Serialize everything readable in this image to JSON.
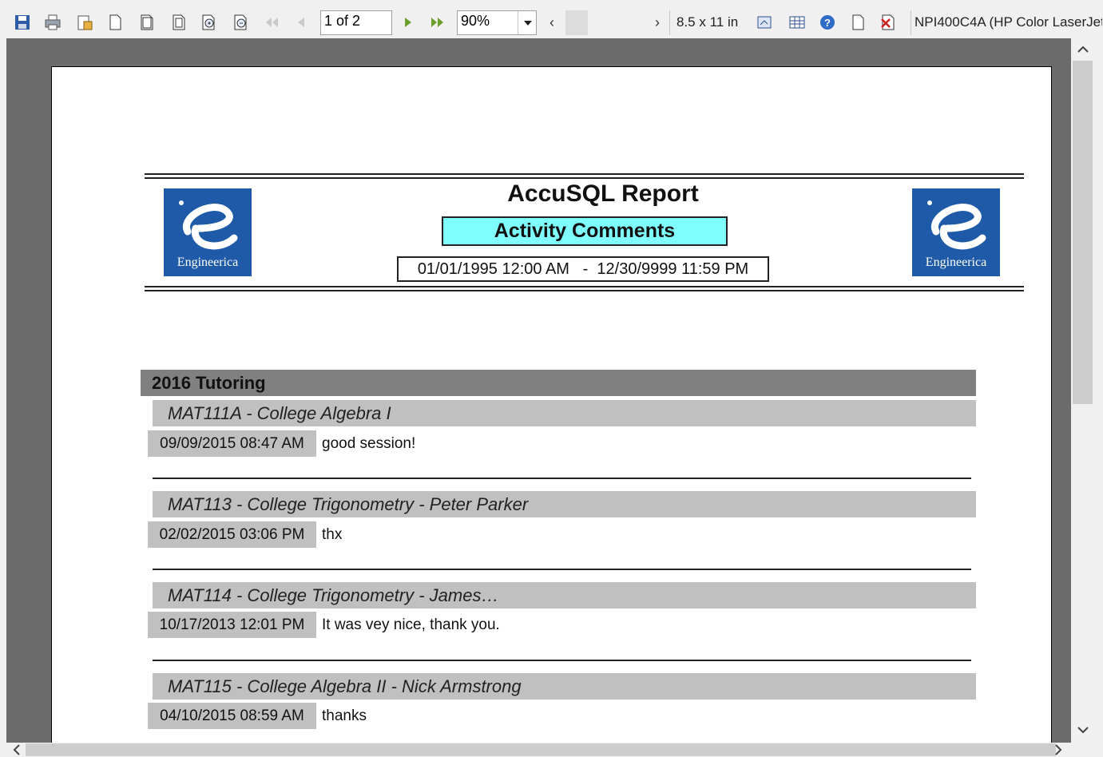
{
  "toolbar": {
    "page_indicator": "1 of 2",
    "zoom": "90%",
    "paper_size": "8.5 x 11 in",
    "printer": "NPI400C4A (HP Color LaserJet"
  },
  "report": {
    "title": "AccuSQL Report",
    "subtitle": "Activity Comments",
    "date_range": "01/01/1995 12:00 AM   -  12/30/9999 11:59 PM",
    "logo_text": "Engineerica",
    "group": "2016 Tutoring",
    "entries": [
      {
        "course": "MAT111A - College Algebra I",
        "datetime": "09/09/2015 08:47 AM",
        "comment": "good session!"
      },
      {
        "course": "MAT113 - College Trigonometry - Peter Parker",
        "datetime": "02/02/2015 03:06 PM",
        "comment": "thx"
      },
      {
        "course": "MAT114  -  College  Trigonometry  -  James…",
        "datetime": "10/17/2013 12:01 PM",
        "comment": "It was vey nice, thank you."
      },
      {
        "course": "MAT115 - College Algebra II - Nick Armstrong",
        "datetime": "04/10/2015 08:59 AM",
        "comment": "thanks"
      }
    ]
  },
  "colors": {
    "logo_bg": "#1e5aa8",
    "subtitle_bg": "#80ffff",
    "group_bg": "#808080",
    "course_bg": "#c0c0c0"
  }
}
